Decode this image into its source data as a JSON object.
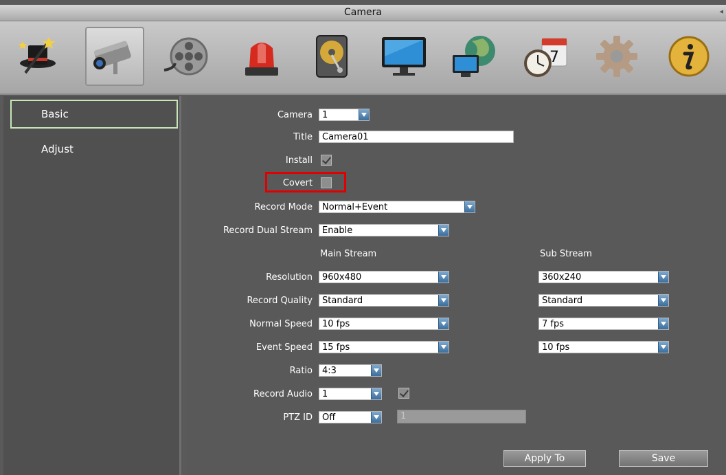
{
  "window": {
    "title": "Camera"
  },
  "toolbar": {
    "icons": [
      "wizard-icon",
      "camera-icon",
      "record-reel-icon",
      "alarm-light-icon",
      "hard-disk-icon",
      "monitor-icon",
      "network-globe-icon",
      "schedule-clock-calendar-icon",
      "settings-gear-icon",
      "info-icon"
    ],
    "selected": "camera-icon",
    "calendar_day": "7"
  },
  "sidebar": {
    "items": [
      {
        "label": "Basic",
        "selected": true
      },
      {
        "label": "Adjust",
        "selected": false
      }
    ]
  },
  "form": {
    "camera": {
      "label": "Camera",
      "value": "1"
    },
    "title": {
      "label": "Title",
      "value": "Camera01"
    },
    "install": {
      "label": "Install",
      "checked": true
    },
    "covert": {
      "label": "Covert",
      "checked": false
    },
    "record_mode": {
      "label": "Record Mode",
      "value": "Normal+Event"
    },
    "record_dual_stream": {
      "label": "Record Dual Stream",
      "value": "Enable"
    },
    "columns": {
      "main": "Main Stream",
      "sub": "Sub Stream"
    },
    "resolution": {
      "label": "Resolution",
      "main": "960x480",
      "sub": "360x240"
    },
    "record_quality": {
      "label": "Record Quality",
      "main": "Standard",
      "sub": "Standard"
    },
    "normal_speed": {
      "label": "Normal Speed",
      "main": "10 fps",
      "sub": "7 fps"
    },
    "event_speed": {
      "label": "Event Speed",
      "main": "15 fps",
      "sub": "10 fps"
    },
    "ratio": {
      "label": "Ratio",
      "value": "4:3"
    },
    "record_audio": {
      "label": "Record Audio",
      "value": "1",
      "checked": true
    },
    "ptz_id": {
      "label": "PTZ ID",
      "value": "Off",
      "address": "1"
    }
  },
  "buttons": {
    "apply_to": "Apply To",
    "save": "Save"
  },
  "colors": {
    "highlight": "#e00000",
    "dropdown": "#3c6f9e",
    "selected_border": "#c8e6b8"
  }
}
